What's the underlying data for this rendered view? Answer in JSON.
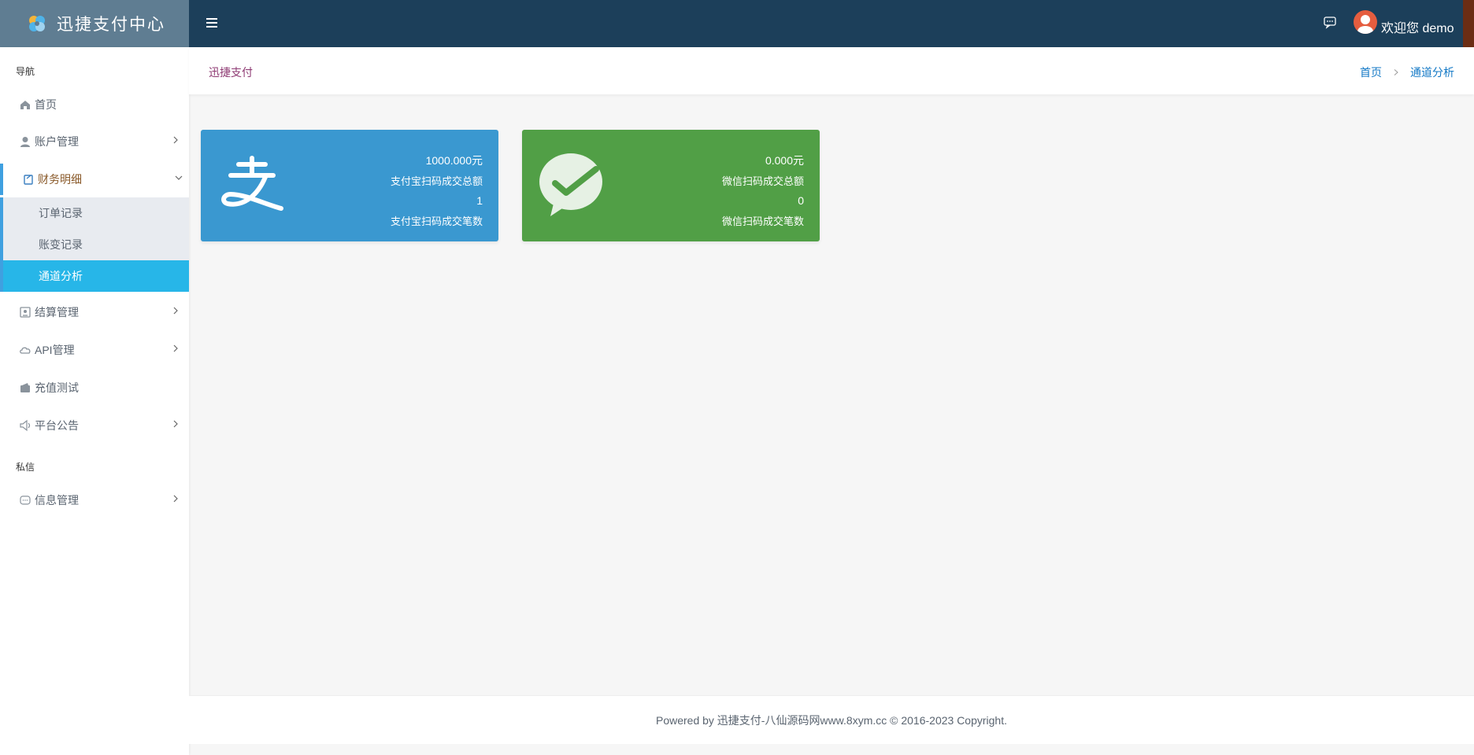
{
  "app": {
    "title": "迅捷支付中心",
    "greeting": "欢迎您 demo"
  },
  "sidebar": {
    "section_nav": "导航",
    "section_private": "私信",
    "items": [
      {
        "label": "首页",
        "icon": "home-icon"
      },
      {
        "label": "账户管理",
        "icon": "user-icon"
      },
      {
        "label": "财务明细",
        "icon": "ledger-icon"
      },
      {
        "label": "结算管理",
        "icon": "settlement-icon"
      },
      {
        "label": "API管理",
        "icon": "cloud-icon"
      },
      {
        "label": "充值测试",
        "icon": "wallet-icon"
      },
      {
        "label": "平台公告",
        "icon": "speaker-icon"
      },
      {
        "label": "信息管理",
        "icon": "message-icon"
      }
    ],
    "sub_items": [
      {
        "label": "订单记录"
      },
      {
        "label": "账变记录"
      },
      {
        "label": "通道分析"
      }
    ]
  },
  "header": {
    "title": "迅捷支付",
    "breadcrumb": [
      "首页",
      "通道分析"
    ]
  },
  "cards": {
    "alipay": {
      "amount": "1000.000元",
      "amount_label": "支付宝扫码成交总额",
      "count": "1",
      "count_label": "支付宝扫码成交笔数",
      "color": "#3a98d0"
    },
    "wechat": {
      "amount": "0.000元",
      "amount_label": "微信扫码成交总额",
      "count": "0",
      "count_label": "微信扫码成交笔数",
      "color": "#519f46"
    }
  },
  "footer": {
    "text": "Powered by 迅捷支付-八仙源码网www.8xym.cc © 2016-2023 Copyright."
  },
  "colors": {
    "topbar": "#1c3f5a",
    "brand_bg": "#5f7d92",
    "selected_sub": "#27b6e8",
    "accent_border": "#3fa0e0"
  }
}
